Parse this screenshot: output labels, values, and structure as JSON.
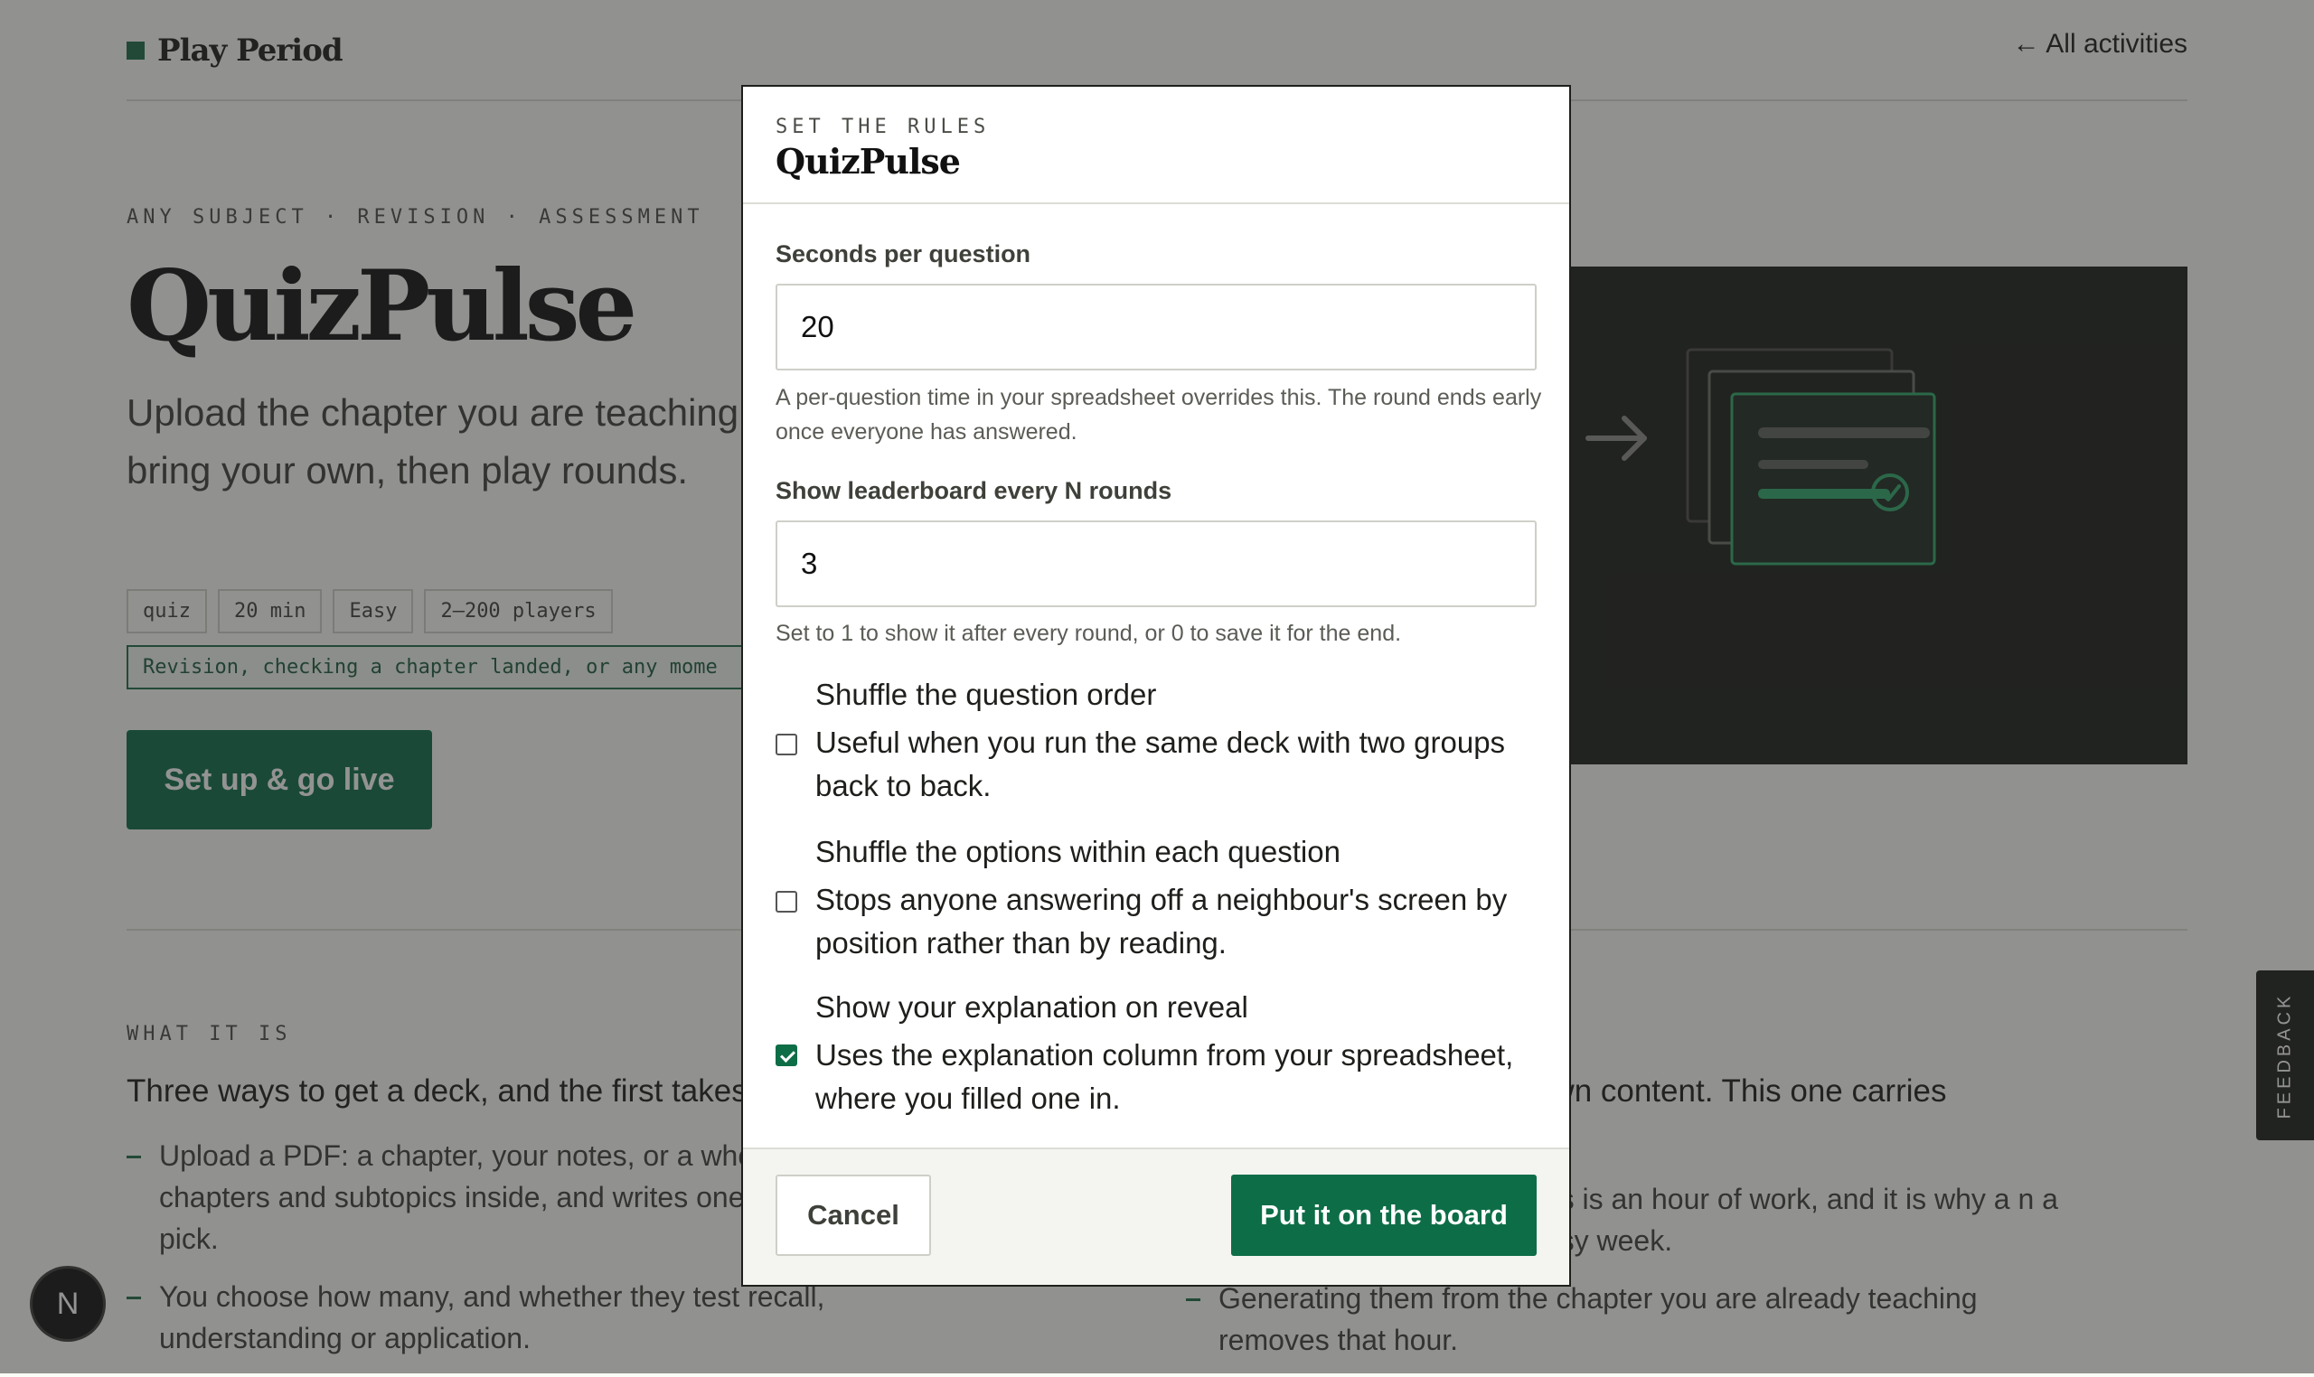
{
  "header": {
    "logo_text": "Play Period",
    "back_link": "← All activities"
  },
  "hero": {
    "eyebrow": "ANY SUBJECT · REVISION · ASSESSMENT",
    "title": "QuizPulse",
    "description": "Upload the chapter you are teaching from it, or bring your own, then play rounds.",
    "chips": [
      "quiz",
      "20 min",
      "Easy",
      "2–200 players"
    ],
    "use_case": "Revision, checking a chapter landed, or any mome",
    "cta_label": "Set up & go live"
  },
  "what": {
    "label": "WHAT IT IS",
    "left_heading": "Three ways to get a deck, and the first takes",
    "right_heading": "ts own content. This one carries",
    "left_bullets": [
      "Upload a PDF: a chapter, your notes, or a whole the chapters and subtopics inside, and writes ones you pick.",
      "You choose how many, and whether they test recall, understanding or application."
    ],
    "right_bullet_clip": "ons is an hour of work, and it is why a n a busy week.",
    "right_bullets": [
      "Generating them from the chapter you are already teaching removes that hour."
    ]
  },
  "feedback_label": "FEEDBACK",
  "avatar_letter": "N",
  "modal": {
    "eyebrow": "SET THE RULES",
    "title": "QuizPulse",
    "seconds_label": "Seconds per question",
    "seconds_value": "20",
    "seconds_help": "A per-question time in your spreadsheet overrides this. The round ends early once everyone has answered.",
    "leaderboard_label": "Show leaderboard every N rounds",
    "leaderboard_value": "3",
    "leaderboard_help": "Set to 1 to show it after every round, or 0 to save it for the end.",
    "options": [
      {
        "title": "Shuffle the question order",
        "description": "Useful when you run the same deck with two groups back to back.",
        "checked": false
      },
      {
        "title": "Shuffle the options within each question",
        "description": "Stops anyone answering off a neighbour's screen by position rather than by reading.",
        "checked": false
      },
      {
        "title": "Show your explanation on reveal",
        "description": "Uses the explanation column from your spreadsheet, where you filled one in.",
        "checked": true
      }
    ],
    "cancel_label": "Cancel",
    "submit_label": "Put it on the board"
  },
  "colors": {
    "accent": "#0d6d47",
    "ink": "#1d1f1b",
    "overlay": "rgba(40,40,40,0.5)"
  }
}
